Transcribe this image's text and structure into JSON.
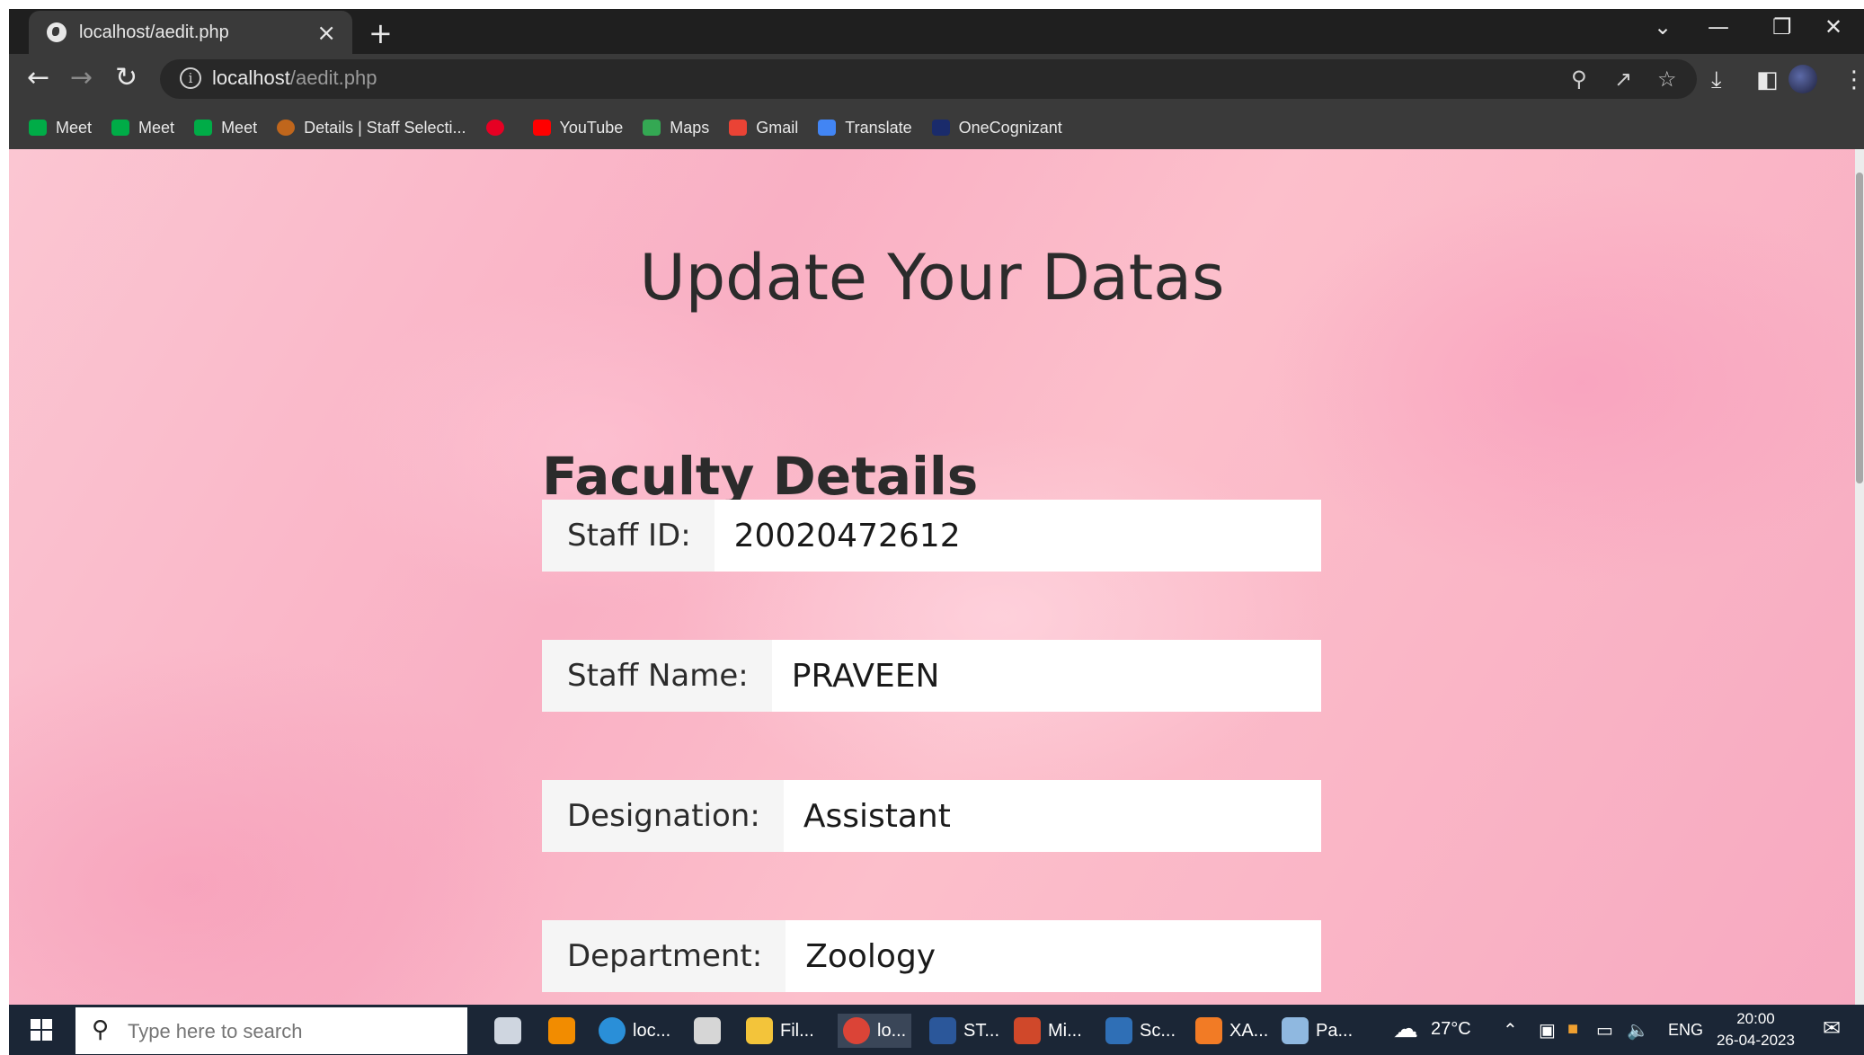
{
  "browser": {
    "tab_title": "localhost/aedit.php",
    "tab_close": "×",
    "new_tab": "+",
    "url_host": "localhost",
    "url_path": "/aedit.php",
    "bookmarks": [
      {
        "label": "Meet",
        "icon": "meet-icon",
        "color": "#00ac47"
      },
      {
        "label": "Meet",
        "icon": "meet-icon",
        "color": "#00ac47"
      },
      {
        "label": "Meet",
        "icon": "meet-icon",
        "color": "#00ac47"
      },
      {
        "label": "Details | Staff Selecti...",
        "icon": "ssc-icon",
        "color": "#c0661c"
      },
      {
        "label": "",
        "icon": "pinterest-icon",
        "color": "#e60023"
      },
      {
        "label": "YouTube",
        "icon": "youtube-icon",
        "color": "#ff0000"
      },
      {
        "label": "Maps",
        "icon": "maps-icon",
        "color": "#34a853"
      },
      {
        "label": "Gmail",
        "icon": "gmail-icon",
        "color": "#ea4335"
      },
      {
        "label": "Translate",
        "icon": "translate-icon",
        "color": "#4285f4"
      },
      {
        "label": "OneCognizant",
        "icon": "onecognizant-icon",
        "color": "#1a2b6b"
      }
    ]
  },
  "page": {
    "title": "Update Your Datas",
    "section_title": "Faculty Details",
    "fields": [
      {
        "label": "Staff ID:",
        "value": "20020472612"
      },
      {
        "label": "Staff Name:",
        "value": "PRAVEEN"
      },
      {
        "label": "Designation:",
        "value": "Assistant"
      },
      {
        "label": "Department:",
        "value": "Zoology"
      }
    ]
  },
  "taskbar": {
    "search_placeholder": "Type here to search",
    "apps": [
      {
        "label": "",
        "icon": "task-view-icon"
      },
      {
        "label": "",
        "icon": "vlc-icon"
      },
      {
        "label": "loc...",
        "icon": "edge-icon"
      },
      {
        "label": "",
        "icon": "store-icon"
      },
      {
        "label": "Fil...",
        "icon": "file-explorer-icon"
      },
      {
        "label": "lo...",
        "icon": "chrome-icon"
      },
      {
        "label": "ST...",
        "icon": "word-icon"
      },
      {
        "label": "Mi...",
        "icon": "mi-icon"
      },
      {
        "label": "Sc...",
        "icon": "photos-icon"
      },
      {
        "label": "XA...",
        "icon": "xampp-icon"
      },
      {
        "label": "Pa...",
        "icon": "paint-icon"
      }
    ],
    "weather": "27°C",
    "lang": "ENG",
    "time": "20:00",
    "date": "26-04-2023"
  }
}
